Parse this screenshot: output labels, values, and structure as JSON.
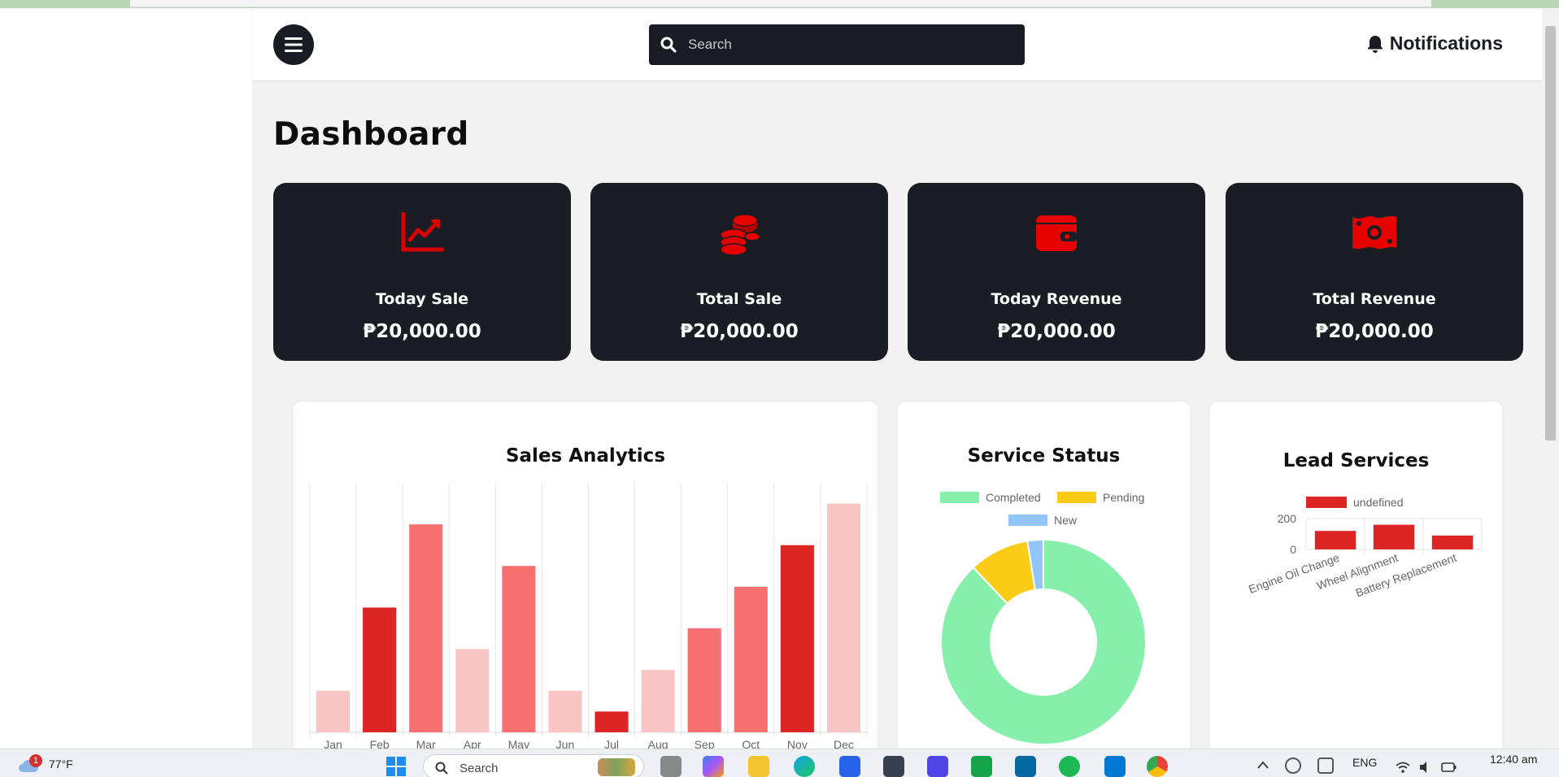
{
  "header": {
    "search_placeholder": "Search",
    "notifications_label": "Notifications"
  },
  "page": {
    "title": "Dashboard"
  },
  "cards": [
    {
      "label": "Today Sale",
      "value": "₱20,000.00",
      "icon": "chart-line-icon"
    },
    {
      "label": "Total Sale",
      "value": "₱20,000.00",
      "icon": "coins-icon"
    },
    {
      "label": "Today Revenue",
      "value": "₱20,000.00",
      "icon": "wallet-icon"
    },
    {
      "label": "Total Revenue",
      "value": "₱20,000.00",
      "icon": "money-bill-icon"
    }
  ],
  "colors": {
    "accent_red": "#d90000",
    "card_bg": "#1b1d25",
    "bar_dark": "#dc2626",
    "bar_mid": "#f87171",
    "bar_light": "#f8c4c4",
    "completed": "#86efac",
    "pending": "#facc15",
    "new": "#93c5fd"
  },
  "chart_data": [
    {
      "type": "bar",
      "title": "Sales Analytics",
      "categories": [
        "Jan",
        "Feb",
        "Mar",
        "Apr",
        "May",
        "Jun",
        "Jul",
        "Aug",
        "Sep",
        "Oct",
        "Nov",
        "Dec"
      ],
      "values": [
        20,
        60,
        100,
        40,
        80,
        20,
        10,
        30,
        50,
        70,
        90,
        110
      ],
      "bar_colors": [
        "#f8c4c4",
        "#dc2626",
        "#f87171",
        "#f8c4c4",
        "#f87171",
        "#f8c4c4",
        "#dc2626",
        "#f8c4c4",
        "#f87171",
        "#f87171",
        "#dc2626",
        "#f8c4c4"
      ],
      "ylim": [
        0,
        120
      ],
      "grid": true,
      "legend": "none"
    },
    {
      "type": "pie",
      "title": "Service Status",
      "labels": [
        "Completed",
        "Pending",
        "New"
      ],
      "values": [
        88,
        9.5,
        2.5
      ],
      "colors": [
        "#86efac",
        "#facc15",
        "#93c5fd"
      ],
      "legend": "top"
    },
    {
      "type": "bar",
      "title": "Lead Services",
      "categories": [
        "Engine Oil Change",
        "Wheel Alignment",
        "Battery Replacement"
      ],
      "series": [
        {
          "name": "undefined",
          "values": [
            120,
            160,
            90
          ]
        }
      ],
      "yticks": [
        "200",
        "0"
      ],
      "ylim": [
        0,
        200
      ],
      "legend": "top"
    }
  ],
  "taskbar": {
    "weather_temp": "77°F",
    "weather_badge": "1",
    "search_label": "Search",
    "language": "ENG",
    "clock": "12:40 am"
  }
}
